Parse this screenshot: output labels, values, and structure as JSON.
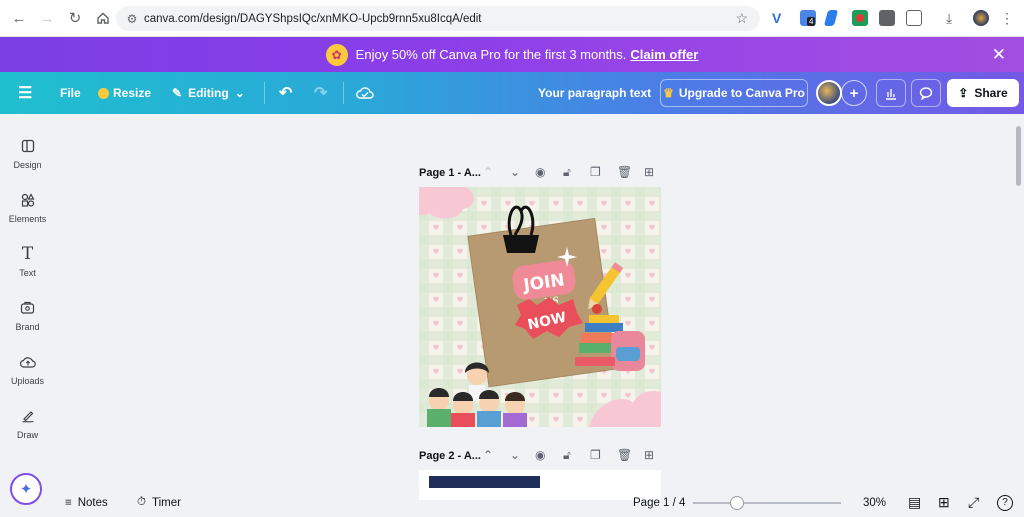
{
  "browser": {
    "url": "canva.com/design/DAGYShpsIQc/xnMKO-Upcb9rnn5xu8IcqA/edit",
    "extension_badge": "4"
  },
  "promo": {
    "text": "Enjoy 50% off Canva Pro for the first 3 months.",
    "link": "Claim offer"
  },
  "toolbar": {
    "file": "File",
    "resize": "Resize",
    "editing": "Editing",
    "title": "Your paragraph text",
    "upgrade": "Upgrade to Canva Pro",
    "share": "Share"
  },
  "sidebar": {
    "items": [
      {
        "label": "Design",
        "icon": "design-icon"
      },
      {
        "label": "Elements",
        "icon": "elements-icon"
      },
      {
        "label": "Text",
        "icon": "text-icon"
      },
      {
        "label": "Brand",
        "icon": "brand-icon"
      },
      {
        "label": "Uploads",
        "icon": "uploads-icon"
      },
      {
        "label": "Draw",
        "icon": "draw-icon"
      }
    ]
  },
  "pages": {
    "page1_label": "Page 1 - A...",
    "page2_label": "Page 2 - A...",
    "design_text": {
      "join": "JOIN",
      "us": "us",
      "now": "NOW"
    }
  },
  "footer": {
    "notes": "Notes",
    "timer": "Timer",
    "page_indicator": "Page 1 / 4",
    "zoom": "30%",
    "zoom_fraction": 0.3
  },
  "colors": {
    "promo": "#8a3ee8",
    "toolbar_start": "#1fbfcf",
    "toolbar_end": "#7459e6"
  }
}
